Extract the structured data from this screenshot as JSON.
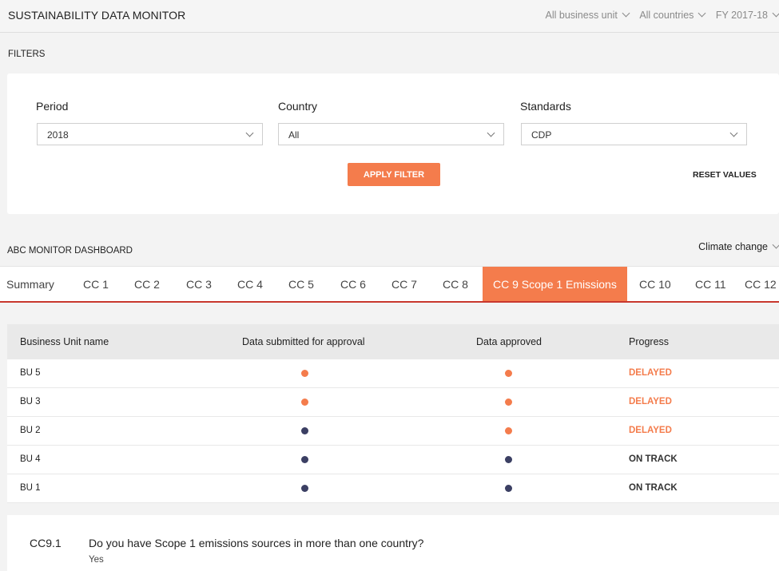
{
  "app": {
    "title": "SUSTAINABILITY DATA MONITOR",
    "top_filters": {
      "business_unit": "All business unit",
      "countries": "All countries",
      "fiscal_year": "FY 2017-18"
    }
  },
  "filters": {
    "section_label": "FILTERS",
    "period": {
      "label": "Period",
      "value": "2018"
    },
    "country": {
      "label": "Country",
      "value": "All"
    },
    "standards": {
      "label": "Standards",
      "value": "CDP"
    },
    "apply_label": "APPLY FILTER",
    "reset_label": "RESET VALUES"
  },
  "dashboard": {
    "title": "ABC MONITOR DASHBOARD",
    "category": "Climate change",
    "tabs": [
      "Summary",
      "CC 1",
      "CC 2",
      "CC 3",
      "CC 4",
      "CC 5",
      "CC 6",
      "CC 7",
      "CC 8",
      "CC 9 Scope 1 Emissions",
      "CC 10",
      "CC 11",
      "CC 12"
    ],
    "active_tab": "CC 9 Scope 1 Emissions"
  },
  "table": {
    "headers": {
      "bu": "Business Unit name",
      "submitted": "Data submitted for approval",
      "approved": "Data approved",
      "progress": "Progress"
    },
    "rows": [
      {
        "bu": "BU 5",
        "submitted": "orange",
        "approved": "orange",
        "progress": "DELAYED"
      },
      {
        "bu": "BU 3",
        "submitted": "orange",
        "approved": "orange",
        "progress": "DELAYED"
      },
      {
        "bu": "BU 2",
        "submitted": "navy",
        "approved": "orange",
        "progress": "DELAYED"
      },
      {
        "bu": "BU 4",
        "submitted": "navy",
        "approved": "navy",
        "progress": "ON TRACK"
      },
      {
        "bu": "BU 1",
        "submitted": "navy",
        "approved": "navy",
        "progress": "ON TRACK"
      }
    ],
    "status_colors": {
      "orange": "#f47c4c",
      "navy": "#3b3f63"
    }
  },
  "question": {
    "number": "CC9.1",
    "text": "Do you have Scope 1 emissions sources in more than one country?",
    "answer": "Yes"
  },
  "colors": {
    "accent": "#f47c4c",
    "tab_underline": "#c8372d"
  }
}
